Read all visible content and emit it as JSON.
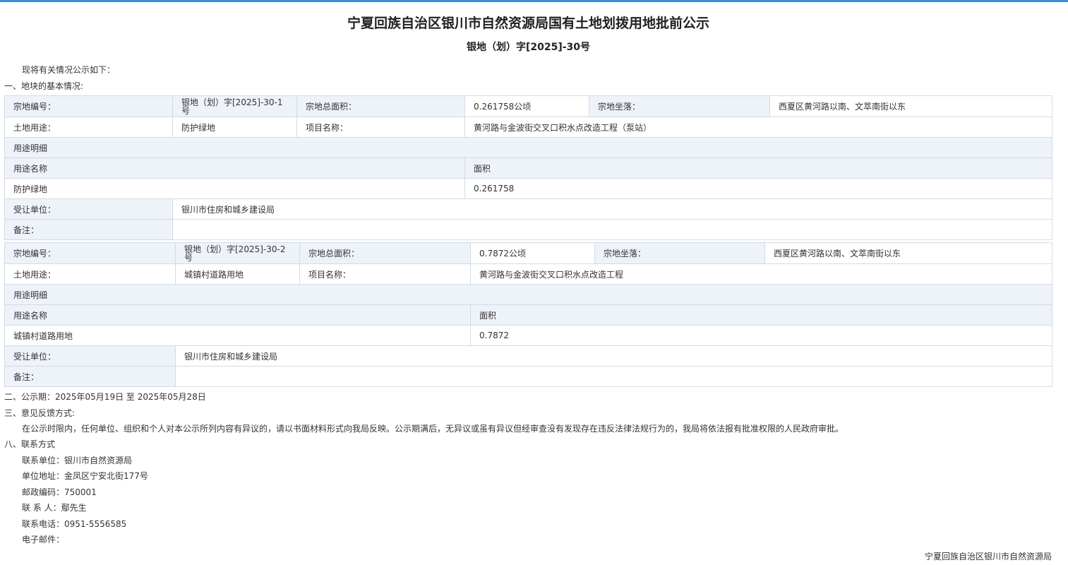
{
  "title": "宁夏回族自治区银川市自然资源局国有土地划拨用地批前公示",
  "doc_no": "银地（划）字[2025]-30号",
  "intro": "现将有关情况公示如下：",
  "section1": "一、地块的基本情况:",
  "labels": {
    "parcel_no": "宗地编号：",
    "total_area": "宗地总面积：",
    "location": "宗地坐落：",
    "land_use": "土地用途：",
    "project_name": "项目名称：",
    "use_detail": "用途明细",
    "use_name": "用途名称",
    "area": "面积",
    "grantee": "受让单位：",
    "remarks": "备注："
  },
  "parcels": [
    {
      "parcel_no": "银地（划）字[2025]-30-1号",
      "total_area": "0.261758公顷",
      "location": "西夏区黄河路以南、文萃南街以东",
      "land_use": "防护绿地",
      "project_name": "黄河路与金波街交叉口积水点改造工程（泵站）",
      "detail_use": "防护绿地",
      "detail_area": "0.261758",
      "grantee": "银川市住房和城乡建设局",
      "remarks": ""
    },
    {
      "parcel_no": "银地（划）字[2025]-30-2号",
      "total_area": "0.7872公顷",
      "location": "西夏区黄河路以南、文萃南街以东",
      "land_use": "城镇村道路用地",
      "project_name": "黄河路与金波街交叉口积水点改造工程",
      "detail_use": "城镇村道路用地",
      "detail_area": "0.7872",
      "grantee": "银川市住房和城乡建设局",
      "remarks": ""
    }
  ],
  "section2": "二、公示期：2025年05月19日 至 2025年05月28日",
  "section3": "三、意见反馈方式:",
  "feedback": "在公示时限内，任何单位、组织和个人对本公示所列内容有异议的，请以书面材料形式向我局反映。公示期满后，无异议或虽有异议但经审查没有发现存在违反法律法规行为的，我局将依法报有批准权限的人民政府审批。",
  "section8": "八、联系方式",
  "contacts": [
    "联系单位：银川市自然资源局",
    "单位地址：金凤区宁安北街177号",
    "邮政编码：750001",
    "联 系 人：鄢先生",
    "联系电话：0951-5556585",
    "电子邮件："
  ],
  "footer": "宁夏回族自治区银川市自然资源局"
}
